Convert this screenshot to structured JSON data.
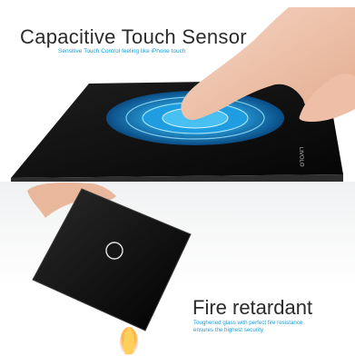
{
  "top_feature": {
    "title": "Capacitive Touch Sensor",
    "subtitle": "Sensitive Touch Control feeling like iPhone touch"
  },
  "bottom_feature": {
    "title": "Fire retardant",
    "description_line1": "Toughened glass with perfect fire resistance",
    "description_line2": "ensures the highest  security"
  },
  "panel_brand_text": "LIVOLO",
  "colors": {
    "accent_blue": "#1a9fd9",
    "glass_black": "#0b0b0b",
    "ripple_blue": "#2aa8e8",
    "flame": "#ffb13b"
  }
}
